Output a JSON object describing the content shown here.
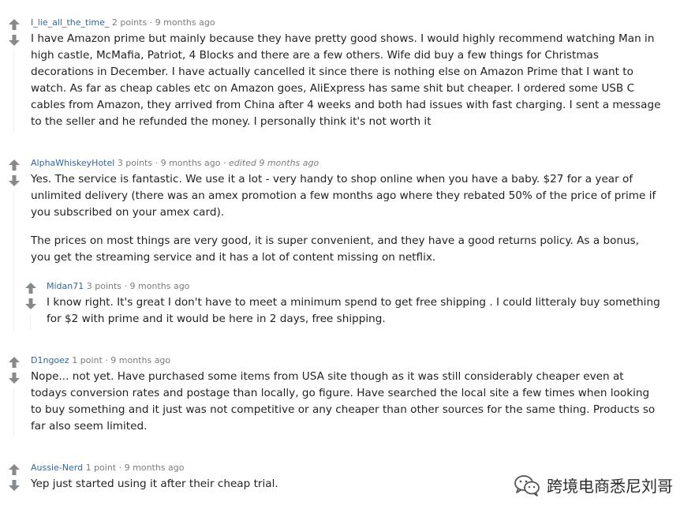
{
  "comments": [
    {
      "author": "I_lie_all_the_time_",
      "points": "2 points",
      "age": "9 months ago",
      "paragraphs": [
        "I have Amazon prime but mainly because they have pretty good shows. I would highly recommend watching Man in high castle, McMafia, Patriot, 4 Blocks and there are a few others. Wife did buy a few things for Christmas decorations in December. I have actually cancelled it since there is nothing else on Amazon Prime that I want to watch. As far as cheap cables etc on Amazon goes, AliExpress has same shit but cheaper. I ordered some USB C cables from Amazon, they arrived from China after 4 weeks and both had issues with fast charging. I sent a message to the seller and he refunded the money. I personally think it's not worth it"
      ]
    },
    {
      "author": "AlphaWhiskeyHotel",
      "points": "3 points",
      "age": "9 months ago",
      "edited": "edited 9 months ago",
      "paragraphs": [
        "Yes. The service is fantastic. We use it a lot - very handy to shop online when you have a baby. $27 for a year of unlimited delivery (there was an amex promotion a few months ago where they rebated 50% of the price of prime if you subscribed on your amex card).",
        "The prices on most things are very good, it is super convenient, and they have a good returns policy. As a bonus, you get the streaming service and it has a lot of content missing on netflix."
      ],
      "reply": {
        "author": "Midan71",
        "points": "3 points",
        "age": "9 months ago",
        "paragraphs": [
          "I know right. It's great I don't have to meet a minimum spend to get free shipping . I could litteraly buy something for $2 with prime and it would be here in 2 days, free shipping."
        ]
      }
    },
    {
      "author": "D1ngoez",
      "points": "1 point",
      "age": "9 months ago",
      "paragraphs": [
        "Nope... not yet. Have purchased some items from USA site though as it was still considerably cheaper even at todays conversion rates and postage than locally, go figure. Have searched the local site a few times when looking to buy something and it just was not competitive or any cheaper than other sources for the same thing. Products so far also seem limited."
      ]
    },
    {
      "author": "Aussie-Nerd",
      "points": "1 point",
      "age": "9 months ago",
      "paragraphs": [
        "Yep just started using it after their cheap trial."
      ]
    }
  ],
  "separator": " · ",
  "watermark": {
    "text": "跨境电商悉尼刘哥",
    "icon": "wechat-icon"
  },
  "colors": {
    "author": "#336699",
    "meta": "#7c7c7c",
    "arrow": "#878a8c",
    "text": "#222222"
  }
}
